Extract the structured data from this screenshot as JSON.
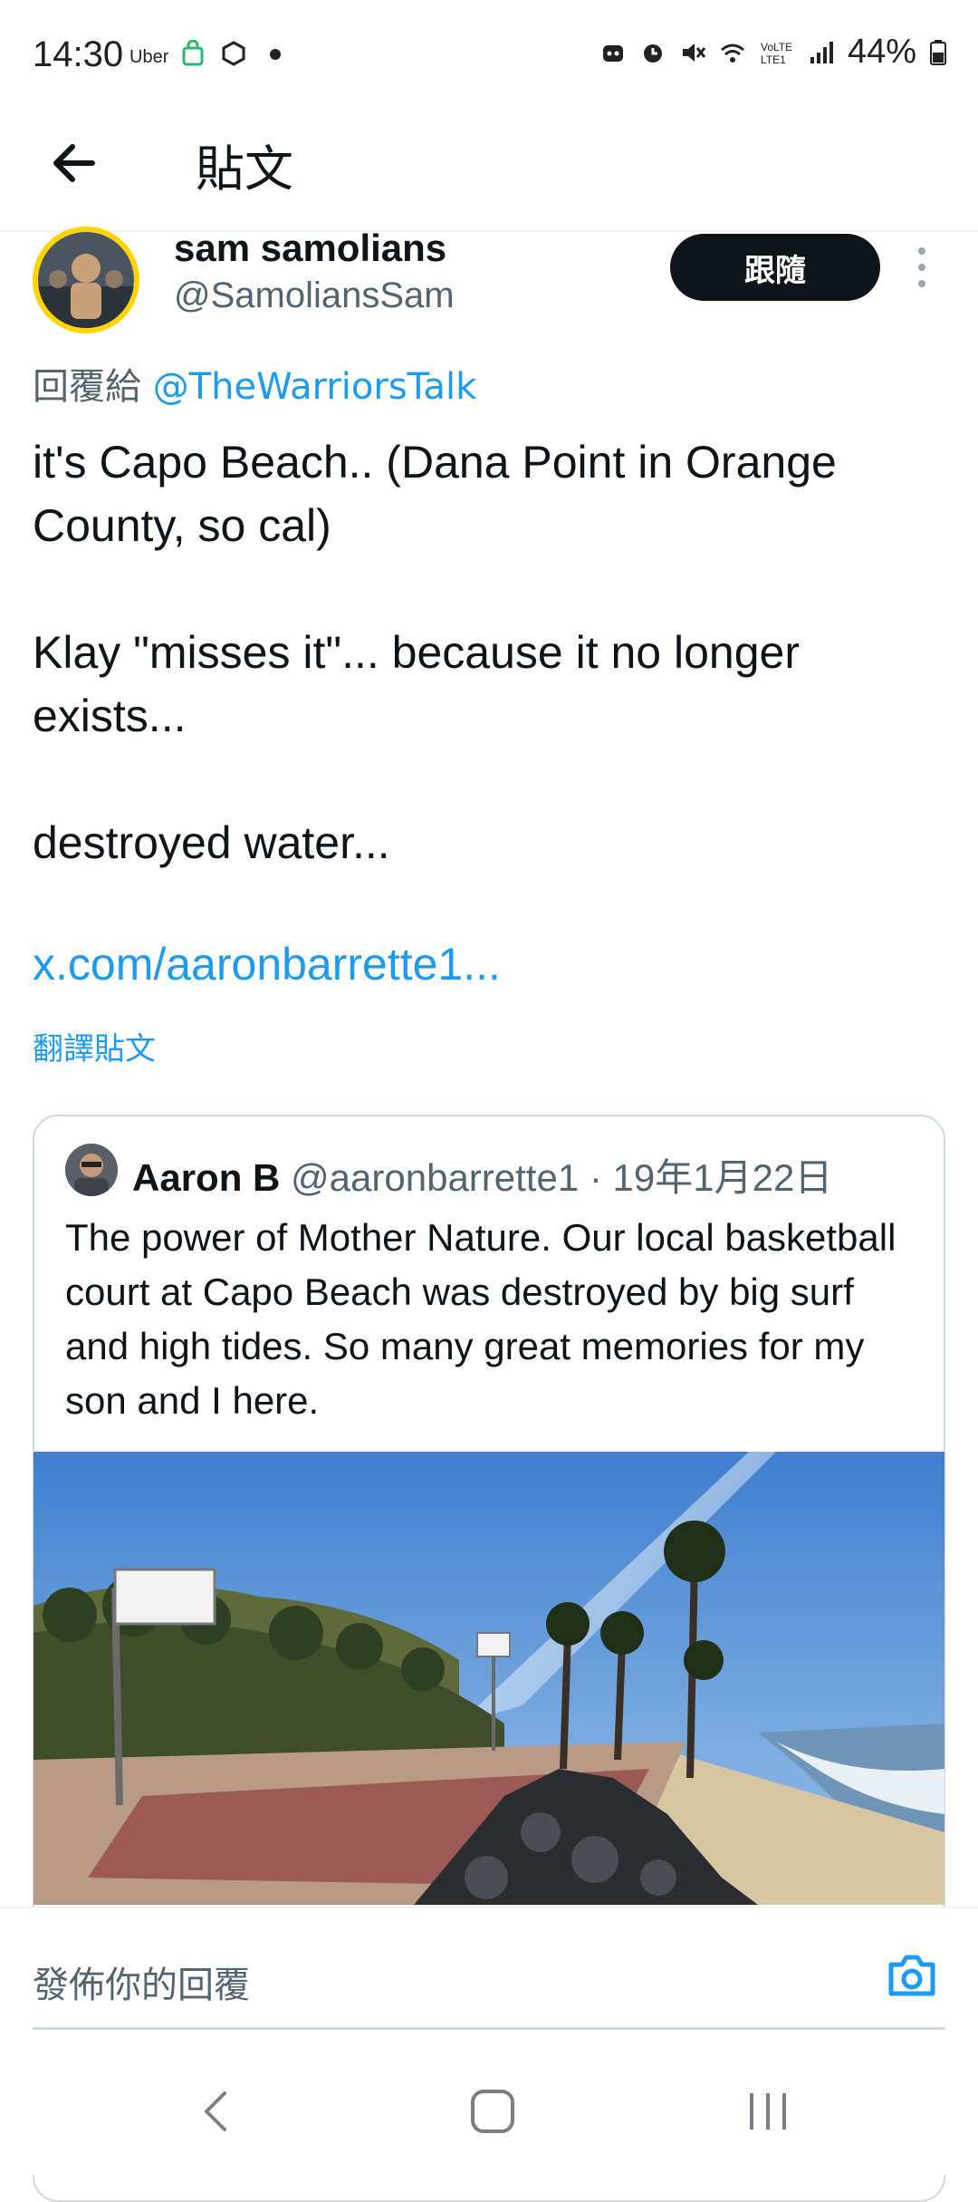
{
  "status_bar": {
    "time": "14:30",
    "uber": "Uber",
    "battery": "44%"
  },
  "header": {
    "title": "貼文"
  },
  "post": {
    "author_name": "sam samolians",
    "author_handle": "@SamoliansSam",
    "follow_label": "跟隨",
    "reply_prefix": "回覆給 ",
    "reply_mention": "@TheWarriorsTalk",
    "text": "it's Capo Beach.. (Dana Point in Orange\nCounty, so cal)\n\nKlay \"misses it\"... because it no longer\nexists...\n\ndestroyed water...",
    "link": "x.com/aaronbarrette1...",
    "translate": "翻譯貼文"
  },
  "quote": {
    "name": "Aaron B",
    "handle": "@aaronbarrette1",
    "separator": " · ",
    "date": "19年1月22日",
    "text": "The power of Mother Nature. Our local basketball court at Capo Beach was destroyed by big surf and high tides. So many great memories for my son and I here."
  },
  "composer": {
    "placeholder": "發佈你的回覆"
  },
  "colors": {
    "accent": "#1d9bf0",
    "text": "#0f1419",
    "secondary": "#536471"
  },
  "icons": [
    "back-arrow-icon",
    "more-vertical-icon",
    "camera-icon",
    "nav-back-icon",
    "nav-home-icon",
    "nav-recents-icon"
  ]
}
